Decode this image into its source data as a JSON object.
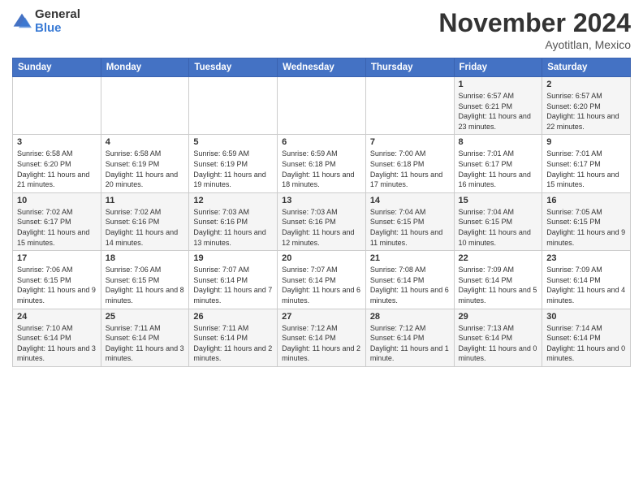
{
  "logo": {
    "general": "General",
    "blue": "Blue"
  },
  "title": "November 2024",
  "location": "Ayotitlan, Mexico",
  "days_header": [
    "Sunday",
    "Monday",
    "Tuesday",
    "Wednesday",
    "Thursday",
    "Friday",
    "Saturday"
  ],
  "weeks": [
    [
      {
        "day": "",
        "info": ""
      },
      {
        "day": "",
        "info": ""
      },
      {
        "day": "",
        "info": ""
      },
      {
        "day": "",
        "info": ""
      },
      {
        "day": "",
        "info": ""
      },
      {
        "day": "1",
        "info": "Sunrise: 6:57 AM\nSunset: 6:21 PM\nDaylight: 11 hours and 23 minutes."
      },
      {
        "day": "2",
        "info": "Sunrise: 6:57 AM\nSunset: 6:20 PM\nDaylight: 11 hours and 22 minutes."
      }
    ],
    [
      {
        "day": "3",
        "info": "Sunrise: 6:58 AM\nSunset: 6:20 PM\nDaylight: 11 hours and 21 minutes."
      },
      {
        "day": "4",
        "info": "Sunrise: 6:58 AM\nSunset: 6:19 PM\nDaylight: 11 hours and 20 minutes."
      },
      {
        "day": "5",
        "info": "Sunrise: 6:59 AM\nSunset: 6:19 PM\nDaylight: 11 hours and 19 minutes."
      },
      {
        "day": "6",
        "info": "Sunrise: 6:59 AM\nSunset: 6:18 PM\nDaylight: 11 hours and 18 minutes."
      },
      {
        "day": "7",
        "info": "Sunrise: 7:00 AM\nSunset: 6:18 PM\nDaylight: 11 hours and 17 minutes."
      },
      {
        "day": "8",
        "info": "Sunrise: 7:01 AM\nSunset: 6:17 PM\nDaylight: 11 hours and 16 minutes."
      },
      {
        "day": "9",
        "info": "Sunrise: 7:01 AM\nSunset: 6:17 PM\nDaylight: 11 hours and 15 minutes."
      }
    ],
    [
      {
        "day": "10",
        "info": "Sunrise: 7:02 AM\nSunset: 6:17 PM\nDaylight: 11 hours and 15 minutes."
      },
      {
        "day": "11",
        "info": "Sunrise: 7:02 AM\nSunset: 6:16 PM\nDaylight: 11 hours and 14 minutes."
      },
      {
        "day": "12",
        "info": "Sunrise: 7:03 AM\nSunset: 6:16 PM\nDaylight: 11 hours and 13 minutes."
      },
      {
        "day": "13",
        "info": "Sunrise: 7:03 AM\nSunset: 6:16 PM\nDaylight: 11 hours and 12 minutes."
      },
      {
        "day": "14",
        "info": "Sunrise: 7:04 AM\nSunset: 6:15 PM\nDaylight: 11 hours and 11 minutes."
      },
      {
        "day": "15",
        "info": "Sunrise: 7:04 AM\nSunset: 6:15 PM\nDaylight: 11 hours and 10 minutes."
      },
      {
        "day": "16",
        "info": "Sunrise: 7:05 AM\nSunset: 6:15 PM\nDaylight: 11 hours and 9 minutes."
      }
    ],
    [
      {
        "day": "17",
        "info": "Sunrise: 7:06 AM\nSunset: 6:15 PM\nDaylight: 11 hours and 9 minutes."
      },
      {
        "day": "18",
        "info": "Sunrise: 7:06 AM\nSunset: 6:15 PM\nDaylight: 11 hours and 8 minutes."
      },
      {
        "day": "19",
        "info": "Sunrise: 7:07 AM\nSunset: 6:14 PM\nDaylight: 11 hours and 7 minutes."
      },
      {
        "day": "20",
        "info": "Sunrise: 7:07 AM\nSunset: 6:14 PM\nDaylight: 11 hours and 6 minutes."
      },
      {
        "day": "21",
        "info": "Sunrise: 7:08 AM\nSunset: 6:14 PM\nDaylight: 11 hours and 6 minutes."
      },
      {
        "day": "22",
        "info": "Sunrise: 7:09 AM\nSunset: 6:14 PM\nDaylight: 11 hours and 5 minutes."
      },
      {
        "day": "23",
        "info": "Sunrise: 7:09 AM\nSunset: 6:14 PM\nDaylight: 11 hours and 4 minutes."
      }
    ],
    [
      {
        "day": "24",
        "info": "Sunrise: 7:10 AM\nSunset: 6:14 PM\nDaylight: 11 hours and 3 minutes."
      },
      {
        "day": "25",
        "info": "Sunrise: 7:11 AM\nSunset: 6:14 PM\nDaylight: 11 hours and 3 minutes."
      },
      {
        "day": "26",
        "info": "Sunrise: 7:11 AM\nSunset: 6:14 PM\nDaylight: 11 hours and 2 minutes."
      },
      {
        "day": "27",
        "info": "Sunrise: 7:12 AM\nSunset: 6:14 PM\nDaylight: 11 hours and 2 minutes."
      },
      {
        "day": "28",
        "info": "Sunrise: 7:12 AM\nSunset: 6:14 PM\nDaylight: 11 hours and 1 minute."
      },
      {
        "day": "29",
        "info": "Sunrise: 7:13 AM\nSunset: 6:14 PM\nDaylight: 11 hours and 0 minutes."
      },
      {
        "day": "30",
        "info": "Sunrise: 7:14 AM\nSunset: 6:14 PM\nDaylight: 11 hours and 0 minutes."
      }
    ]
  ]
}
